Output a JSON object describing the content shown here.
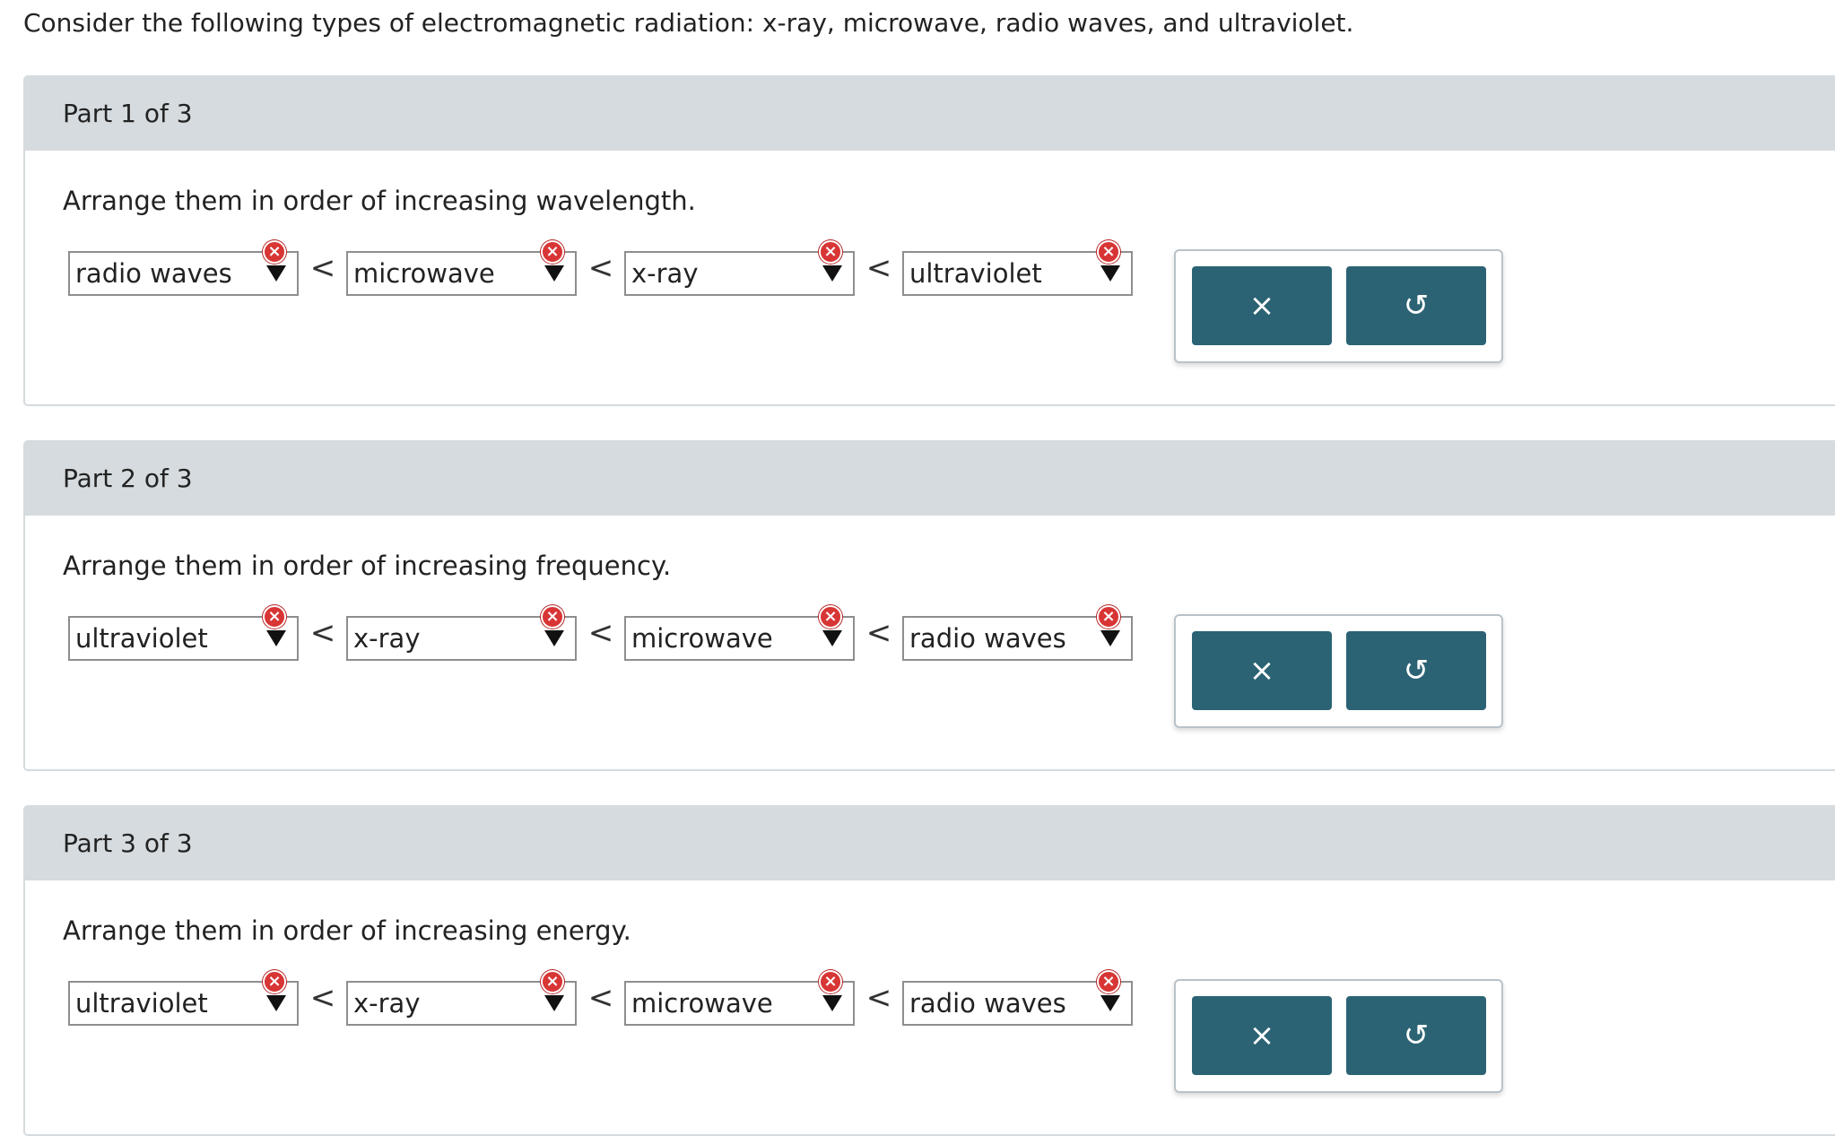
{
  "intro": "Consider the following types of electromagnetic radiation: x-ray, microwave, radio waves, and ultraviolet.",
  "separator": "<",
  "icons": {
    "error": "×",
    "clear": "×",
    "reset": "↺"
  },
  "parts": [
    {
      "header": "Part 1 of 3",
      "prompt": "Arrange them in order of increasing wavelength.",
      "selections": [
        "radio waves",
        "microwave",
        "x-ray",
        "ultraviolet"
      ]
    },
    {
      "header": "Part 2 of 3",
      "prompt": "Arrange them in order of increasing frequency.",
      "selections": [
        "ultraviolet",
        "x-ray",
        "microwave",
        "radio waves"
      ]
    },
    {
      "header": "Part 3 of 3",
      "prompt": "Arrange them in order of increasing energy.",
      "selections": [
        "ultraviolet",
        "x-ray",
        "microwave",
        "radio waves"
      ]
    }
  ]
}
